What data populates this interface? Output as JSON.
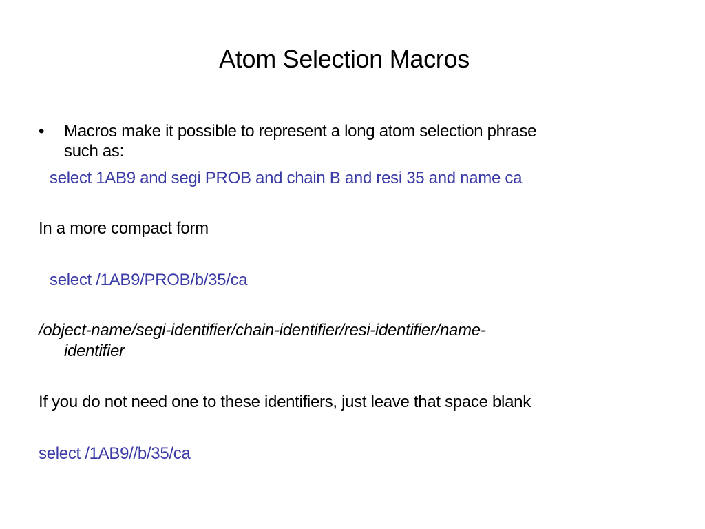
{
  "slide": {
    "title": "Atom Selection Macros",
    "bullet": {
      "marker": "•",
      "line1": "Macros make it possible to represent a long atom selection phrase",
      "line2": "such as:"
    },
    "example_long": "select 1AB9 and segi PROB and chain B and resi 35 and name ca",
    "compact_intro": "In a more compact form",
    "example_compact": "select /1AB9/PROB/b/35/ca",
    "syntax_line1": "/object-name/segi-identifier/chain-identifier/resi-identifier/name-",
    "syntax_line2": "identifier",
    "blank_note": "If you do not need one to these identifiers, just leave that space blank",
    "example_blank": "select /1AB9//b/35/ca",
    "colors": {
      "code_text": "#3a3aa6",
      "body_text": "#000000",
      "background": "#ffffff"
    }
  }
}
